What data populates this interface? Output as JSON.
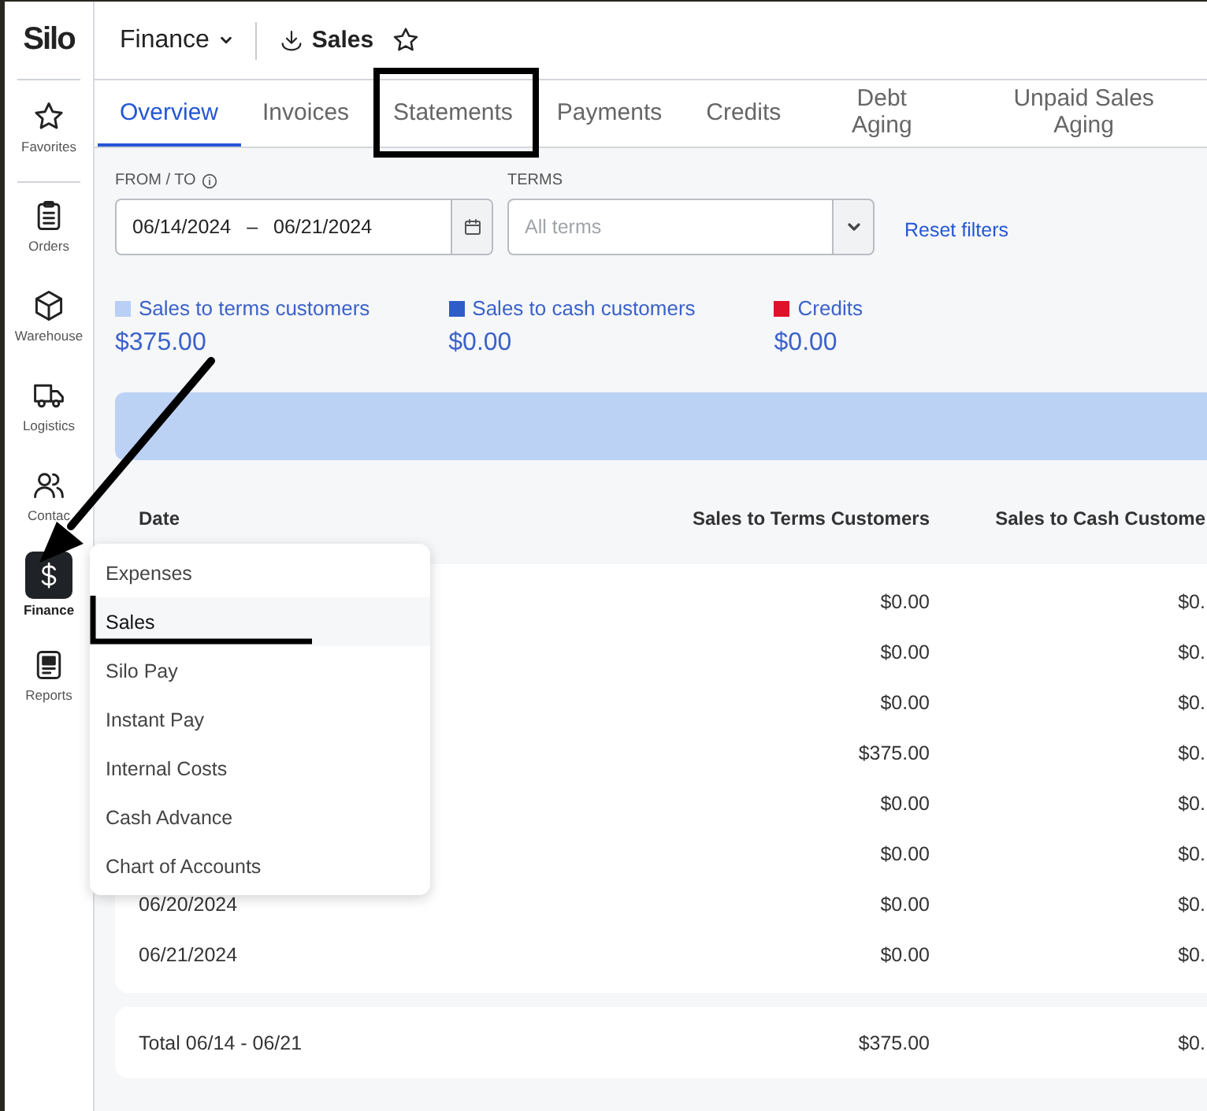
{
  "app": {
    "logo": "Silo"
  },
  "sidebar": {
    "items": [
      {
        "label": "Favorites",
        "kind": "star",
        "selected": false
      },
      {
        "label": "Orders",
        "kind": "clipboard",
        "selected": false
      },
      {
        "label": "Warehouse",
        "kind": "box",
        "selected": false
      },
      {
        "label": "Logistics",
        "kind": "truck",
        "selected": false
      },
      {
        "label": "Contac",
        "kind": "people",
        "selected": false
      },
      {
        "label": "Finance",
        "kind": "dollar",
        "selected": true
      },
      {
        "label": "Reports",
        "kind": "report",
        "selected": false
      }
    ]
  },
  "header": {
    "section": "Finance",
    "page": "Sales"
  },
  "tabs": [
    {
      "label": "Overview",
      "selected": true
    },
    {
      "label": "Invoices",
      "selected": false
    },
    {
      "label": "Statements",
      "selected": false
    },
    {
      "label": "Payments",
      "selected": false
    },
    {
      "label": "Credits",
      "selected": false
    },
    {
      "label": "Debt Aging",
      "selected": false
    },
    {
      "label": "Unpaid Sales Aging",
      "selected": false
    }
  ],
  "filters": {
    "date_label": "FROM / TO",
    "date_from": "06/14/2024",
    "date_separator": "–",
    "date_to": "06/21/2024",
    "terms_label": "TERMS",
    "terms_placeholder": "All terms",
    "reset": "Reset filters"
  },
  "legend": [
    {
      "label": "Sales to terms customers",
      "amount": "$375.00",
      "color": "#b9cff5"
    },
    {
      "label": "Sales to cash customers",
      "amount": "$0.00",
      "color": "#2f5dc8"
    },
    {
      "label": "Credits",
      "amount": "$0.00",
      "color": "#e0112b"
    }
  ],
  "table": {
    "columns": [
      "Date",
      "Sales to Terms Customers",
      "Sales to Cash Custome"
    ],
    "rows": [
      {
        "terms": "$0.00",
        "cash": "$0."
      },
      {
        "terms": "$0.00",
        "cash": "$0."
      },
      {
        "terms": "$0.00",
        "cash": "$0."
      },
      {
        "terms": "$375.00",
        "cash": "$0."
      },
      {
        "terms": "$0.00",
        "cash": "$0."
      },
      {
        "terms": "$0.00",
        "cash": "$0."
      },
      {
        "date": "06/20/2024",
        "terms": "$0.00",
        "cash": "$0."
      },
      {
        "date": "06/21/2024",
        "terms": "$0.00",
        "cash": "$0."
      }
    ],
    "total": {
      "label": "Total 06/14 - 06/21",
      "terms": "$375.00",
      "cash": "$0."
    }
  },
  "menu": {
    "items": [
      {
        "label": "Expenses",
        "selected": false
      },
      {
        "label": "Sales",
        "selected": true
      },
      {
        "label": "Silo Pay",
        "selected": false
      },
      {
        "label": "Instant Pay",
        "selected": false
      },
      {
        "label": "Internal Costs",
        "selected": false
      },
      {
        "label": "Cash Advance",
        "selected": false
      },
      {
        "label": "Chart of Accounts",
        "selected": false
      }
    ]
  },
  "annotations": [
    {
      "kind": "box"
    },
    {
      "kind": "arrow"
    },
    {
      "kind": "underline"
    }
  ]
}
